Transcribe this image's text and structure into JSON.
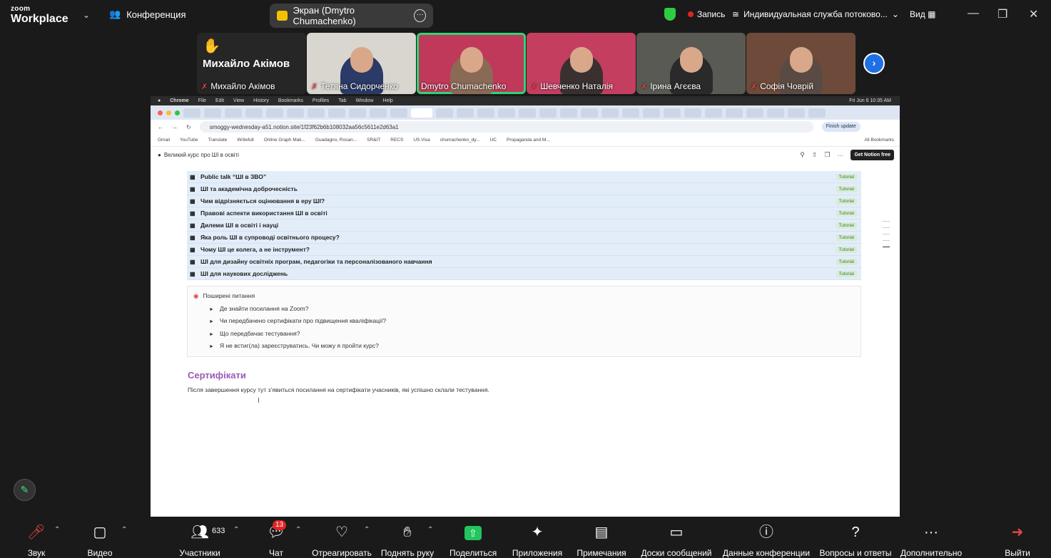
{
  "topbar": {
    "logo_top": "zoom",
    "logo_bottom": "Workplace",
    "conference_label": "Конференция",
    "screen_share_label": "Экран (Dmytro Chumachenko)",
    "record_label": "Запись",
    "live_label": "Индивидуальная служба потоково...",
    "view_label": "Вид"
  },
  "participants": [
    {
      "name": "Михайло Акімов",
      "big_name": "Михайло Акімов"
    },
    {
      "name": "Тетяна Сидорченко"
    },
    {
      "name": "Dmytro Chumachenko"
    },
    {
      "name": "Шевченко Наталія"
    },
    {
      "name": "Ірина Агєєва"
    },
    {
      "name": "Софія Човрій"
    }
  ],
  "mac_menu": [
    "Chrome",
    "File",
    "Edit",
    "View",
    "History",
    "Bookmarks",
    "Profiles",
    "Tab",
    "Window",
    "Help"
  ],
  "mac_clock": "Fri Jun 6  10:35 AM",
  "browser": {
    "url": "smoggy-wednesday-a51.notion.site/1f23f62b6b108032aa56c5611e2d63a1",
    "finish_update": "Finish update",
    "bookmarks": [
      "Gmail",
      "YouTube",
      "Translate",
      "Writefull",
      "Online Graph Mak...",
      "Guadagno, Rosan...",
      "SR&IT",
      "RECS",
      "US Visa",
      "chumachenko_dy...",
      "UC",
      "Propaganda and M..."
    ],
    "all_bookmarks": "All Bookmarks"
  },
  "notion": {
    "page_title": "Великий курс про ШІ в освіті",
    "get_free": "Get Notion free",
    "tutorials": [
      {
        "title": "Public talk “ШІ в ЗВО”",
        "tag": "Tutorial"
      },
      {
        "title": "ШІ та академічна доброчесність",
        "tag": "Tutorial"
      },
      {
        "title": "Чим відрізняється оцінювання в еру ШІ?",
        "tag": "Tutorial"
      },
      {
        "title": "Правові аспекти використання ШІ в освіті",
        "tag": "Tutorial"
      },
      {
        "title": "Дилеми ШІ в освіті і науці",
        "tag": "Tutorial"
      },
      {
        "title": "Яка роль ШІ в супроводі освітнього процесу?",
        "tag": "Tutorial"
      },
      {
        "title": "Чому ШІ це колега, а не інструмент?",
        "tag": "Tutorial"
      },
      {
        "title": "ШІ для дизайну освітніх програм, педагогіки та персоналізованого навчання",
        "tag": "Tutorial"
      },
      {
        "title": "ШІ для наукових досліджень",
        "tag": "Tutorial"
      }
    ],
    "faq_title": "Поширені питання",
    "faq": [
      "Де знайти посилання на Zoom?",
      "Чи передбачено сертифікати про підвищення кваліфікації?",
      "Що передбачає тестування?",
      "Я не встиг(ла) зареєструватись. Чи можу я пройти курс?"
    ],
    "cert_heading": "Сертифікати",
    "cert_text": "Після завершення курсу тут з’явиться посилання на сертифікати учасників, які успішно склали тестування."
  },
  "controls": {
    "audio": "Звук",
    "video": "Видео",
    "participants": "Участники",
    "participants_count": "633",
    "chat": "Чат",
    "chat_badge": "13",
    "react": "Отреагировать",
    "raise_hand": "Поднять руку",
    "share": "Поделиться",
    "apps": "Приложения",
    "notes": "Примечания",
    "whiteboards": "Доски сообщений",
    "info": "Данные конференции",
    "qa": "Вопросы и ответы",
    "more": "Дополнительно",
    "leave": "Выйти"
  },
  "colors": {
    "accent_green": "#2ed573",
    "notion_purple": "#9b59b6",
    "rec_red": "#e02424",
    "share_green": "#22c55e"
  }
}
